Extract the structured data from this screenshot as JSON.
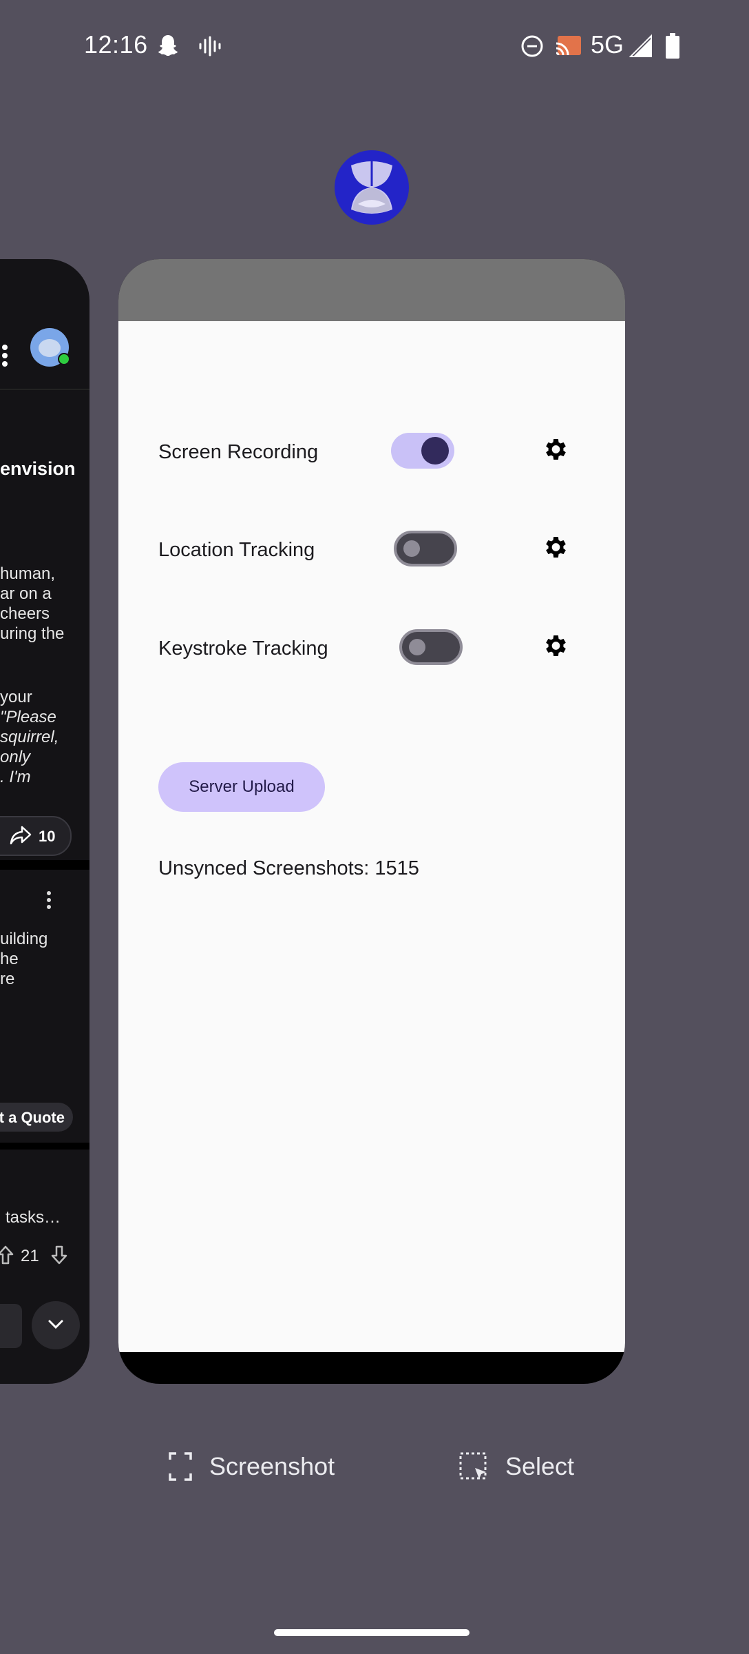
{
  "status_bar": {
    "time": "12:16",
    "network": "5G",
    "icons": [
      "snapchat-icon",
      "audio-wave-icon",
      "do-not-disturb-icon",
      "cast-icon",
      "signal-icon",
      "battery-icon"
    ]
  },
  "app_icon": "app-icon",
  "left_card": {
    "headline": "envision",
    "para1": [
      "human,",
      "ar on a",
      "cheers",
      "uring the"
    ],
    "para2_plain": "your",
    "para2_italic": [
      "\"Please",
      "squirrel,",
      "only",
      ". I'm"
    ],
    "share_count": "10",
    "post2_lines": [
      "uilding",
      "he",
      "re"
    ],
    "quote_button": "t a Quote",
    "post3_text": "l tasks…",
    "vote_count": "21"
  },
  "main_card": {
    "toggles": [
      {
        "label": "Screen Recording",
        "state": "on"
      },
      {
        "label": "Location Tracking",
        "state": "off"
      },
      {
        "label": "Keystroke Tracking",
        "state": "off"
      }
    ],
    "upload_button": "Server Upload",
    "unsynced_text": "Unsynced Screenshots: 1515"
  },
  "actions": {
    "screenshot_label": "Screenshot",
    "select_label": "Select"
  },
  "colors": {
    "background": "#54505d",
    "toggle_on": "#c9c1f7",
    "button": "#cfc3fb"
  }
}
